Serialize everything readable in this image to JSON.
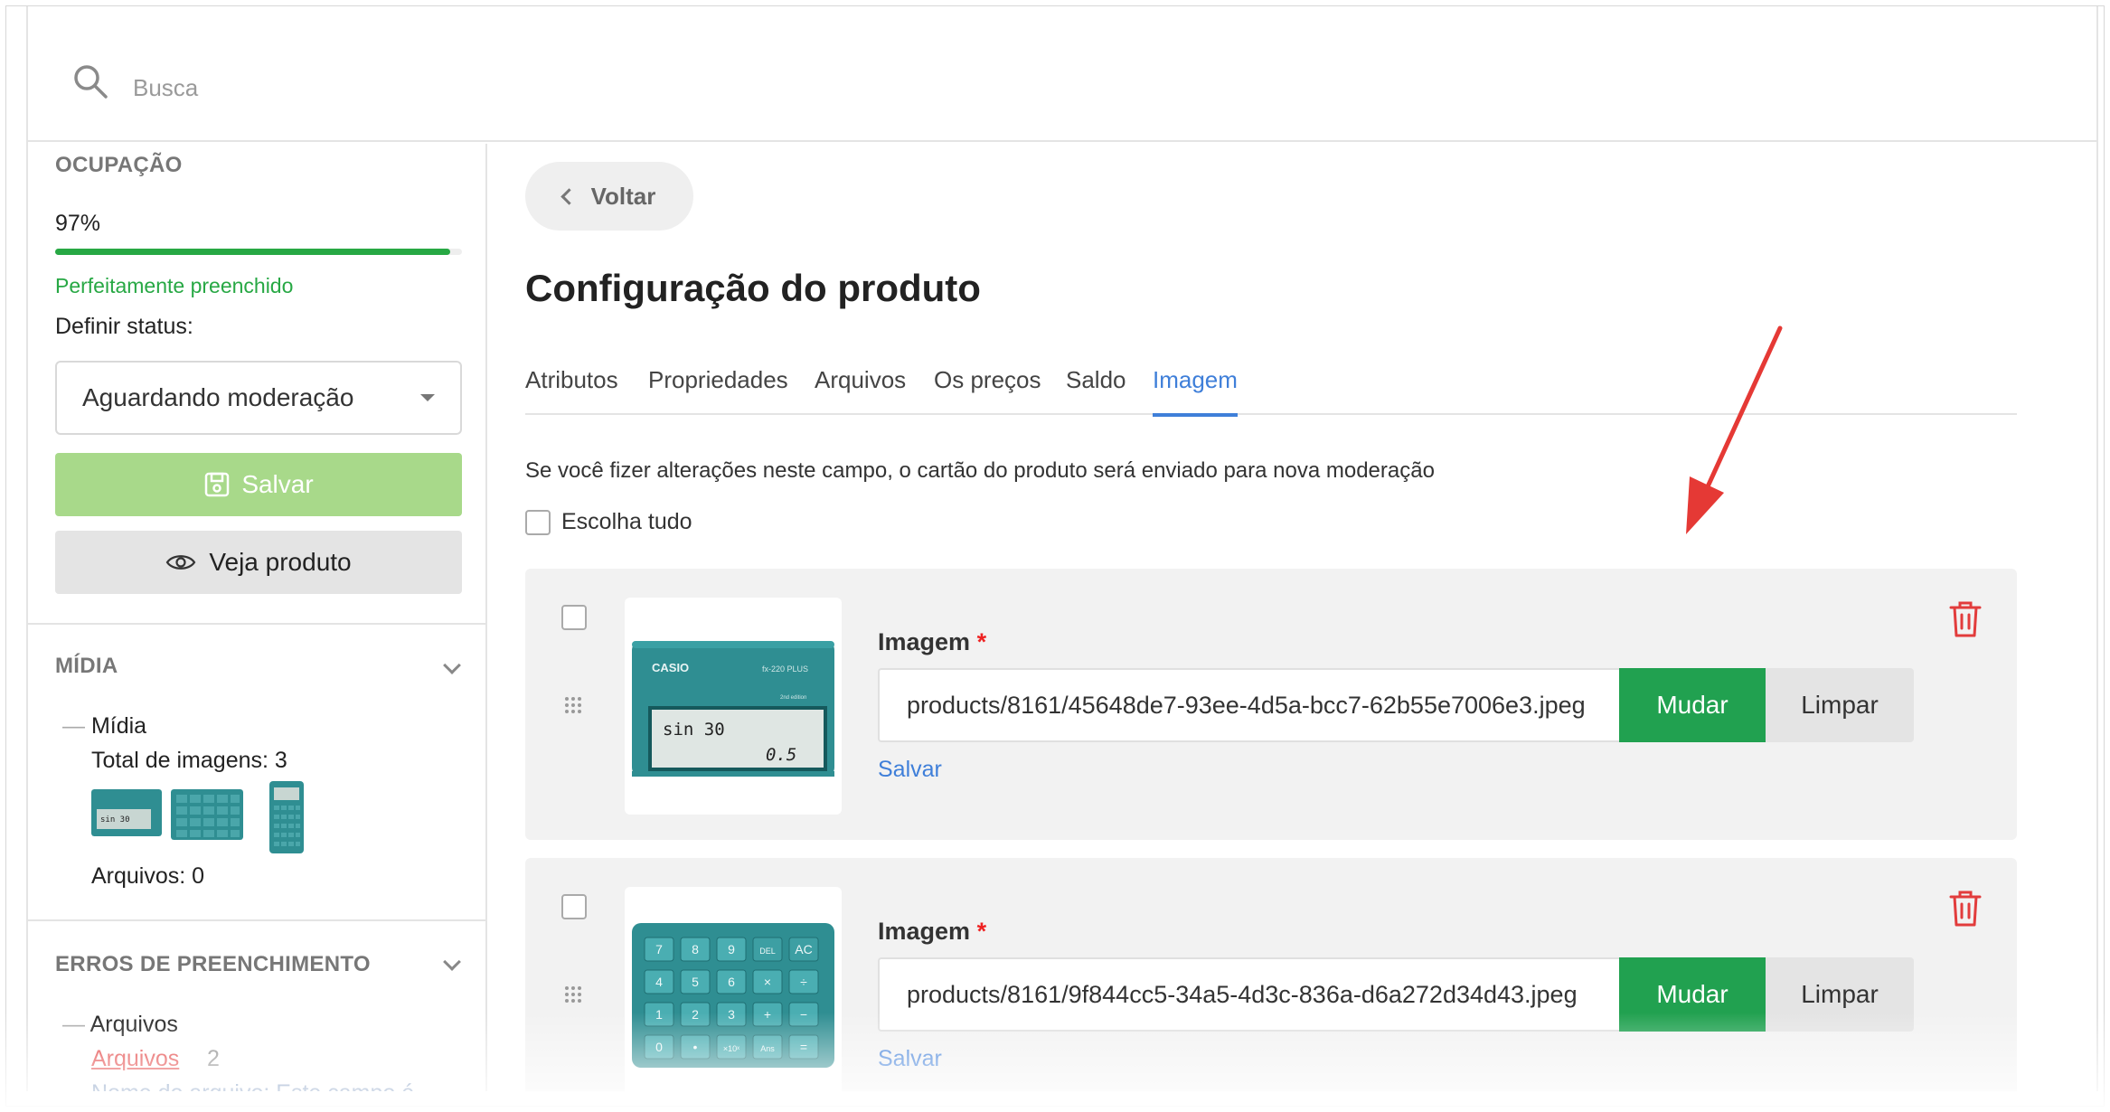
{
  "search": {
    "placeholder": "Busca"
  },
  "sidebar": {
    "occupation_label": "OCUPAÇÃO",
    "occupation_value": "97%",
    "occupation_fraction": 0.97,
    "occupation_status": "Perfeitamente preenchido",
    "status_label": "Definir status:",
    "status_selected": "Aguardando moderação",
    "save_label": "Salvar",
    "view_label": "Veja produto",
    "media_section": "MÍDIA",
    "media_item": "Mídia",
    "total_images": "Total de imagens: 3",
    "files_count": "Arquivos: 0",
    "errors_section": "ERROS DE PREENCHIMENTO",
    "errors_item": "Arquivos",
    "errors_link": "Arquivos",
    "errors_count": "2",
    "errors_note": "Nome do arquivo: Este campo é"
  },
  "main": {
    "back_label": "Voltar",
    "title": "Configuração do produto",
    "tabs": [
      {
        "label": "Atributos"
      },
      {
        "label": "Propriedades"
      },
      {
        "label": "Arquivos"
      },
      {
        "label": "Os preços"
      },
      {
        "label": "Saldo"
      },
      {
        "label": "Imagem",
        "active": true
      }
    ],
    "notice": "Se você fizer alterações neste campo, o cartão do produto será enviado para nova moderação",
    "select_all": "Escolha tudo",
    "images": [
      {
        "field_label": "Imagem",
        "required_mark": "*",
        "path": "products/8161/45648de7-93ee-4d5a-bcc7-62b55e7006e3.jpeg",
        "change_label": "Mudar",
        "clear_label": "Limpar",
        "save_label": "Salvar"
      },
      {
        "field_label": "Imagem",
        "required_mark": "*",
        "path": "products/8161/9f844cc5-34a5-4d3c-836a-d6a272d34d43.jpeg",
        "change_label": "Mudar",
        "clear_label": "Limpar",
        "save_label": "Salvar"
      }
    ],
    "calculator": {
      "brand": "CASIO",
      "model": "fx-220 PLUS",
      "edition": "2nd edition",
      "display_top": "sin 30",
      "display_result": "0.5",
      "keys": [
        "7",
        "8",
        "9",
        "DEL",
        "AC",
        "4",
        "5",
        "6",
        "×",
        "÷",
        "1",
        "2",
        "3",
        "+",
        "−",
        "0",
        "•",
        "×10ˣ",
        "Ans",
        "="
      ]
    }
  },
  "colors": {
    "accent_blue": "#3f7fd9",
    "success_green": "#21a150",
    "progress_green": "#27a844",
    "save_disabled": "#a8d98a",
    "danger_red": "#e23c3c",
    "calculator_teal": "#2f8e92"
  }
}
